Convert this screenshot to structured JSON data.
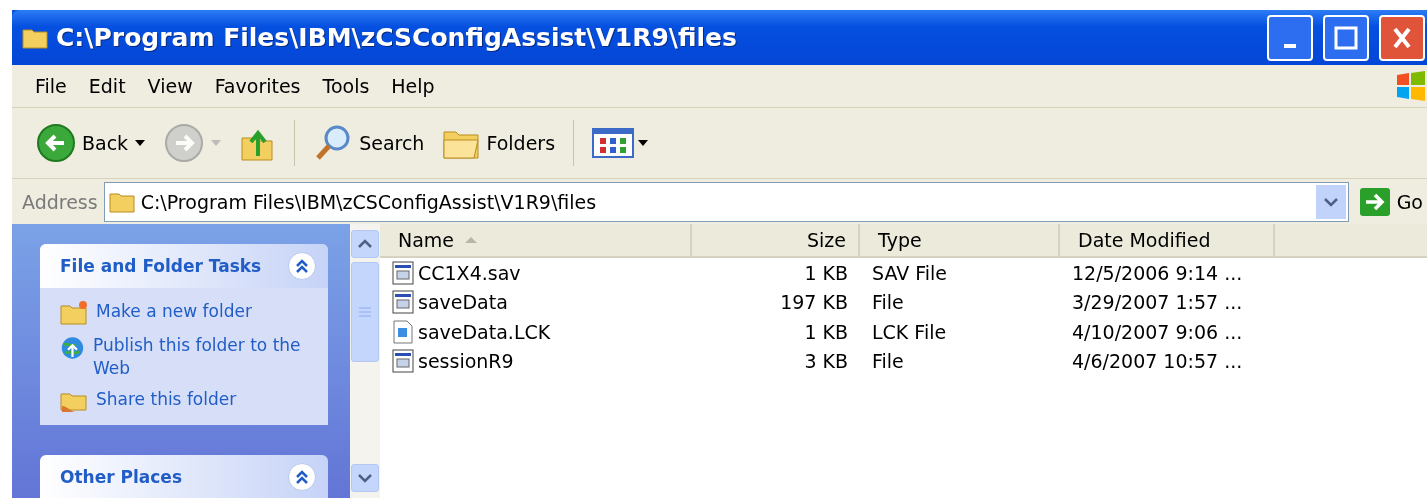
{
  "window": {
    "title": "C:\\Program Files\\IBM\\zCSConfigAssist\\V1R9\\files"
  },
  "menu": [
    "File",
    "Edit",
    "View",
    "Favorites",
    "Tools",
    "Help"
  ],
  "toolbar": [
    {
      "kind": "back",
      "label": "Back",
      "disabled": false
    },
    {
      "kind": "forward",
      "disabled": true
    },
    {
      "kind": "up",
      "disabled": false
    },
    {
      "kind": "search",
      "label": "Search",
      "disabled": false
    },
    {
      "kind": "folders",
      "label": "Folders",
      "disabled": false
    },
    {
      "kind": "views",
      "disabled": false
    }
  ],
  "address": {
    "label": "Address",
    "value": "C:\\Program Files\\IBM\\zCSConfigAssist\\V1R9\\files",
    "go": "Go"
  },
  "panels": [
    {
      "title": "File and Folder Tasks",
      "expanded": true,
      "items": [
        {
          "kind": "new-folder",
          "label": "Make a new folder"
        },
        {
          "kind": "publish",
          "label": "Publish this folder to the Web"
        },
        {
          "kind": "share",
          "label": "Share this folder"
        }
      ]
    },
    {
      "title": "Other Places",
      "expanded": true
    }
  ],
  "table": {
    "columns": [
      {
        "label": "Name",
        "kind": "text",
        "sorted": true
      },
      {
        "label": "Size",
        "kind": "number",
        "sorted": false
      },
      {
        "label": "Type",
        "kind": "text",
        "sorted": false
      },
      {
        "label": "Date Modified",
        "kind": "text",
        "sorted": false
      }
    ],
    "rows": [
      {
        "kind": "app",
        "cells": [
          "CC1X4.sav",
          "1 KB",
          "SAV File",
          "12/5/2006 9:14 ..."
        ]
      },
      {
        "kind": "app",
        "cells": [
          "saveData",
          "197 KB",
          "File",
          "3/29/2007 1:57 ..."
        ]
      },
      {
        "kind": "lock",
        "cells": [
          "saveData.LCK",
          "1 KB",
          "LCK File",
          "4/10/2007 9:06 ..."
        ]
      },
      {
        "kind": "app",
        "cells": [
          "sessionR9",
          "3 KB",
          "File",
          "4/6/2007 10:57 ..."
        ]
      }
    ]
  }
}
